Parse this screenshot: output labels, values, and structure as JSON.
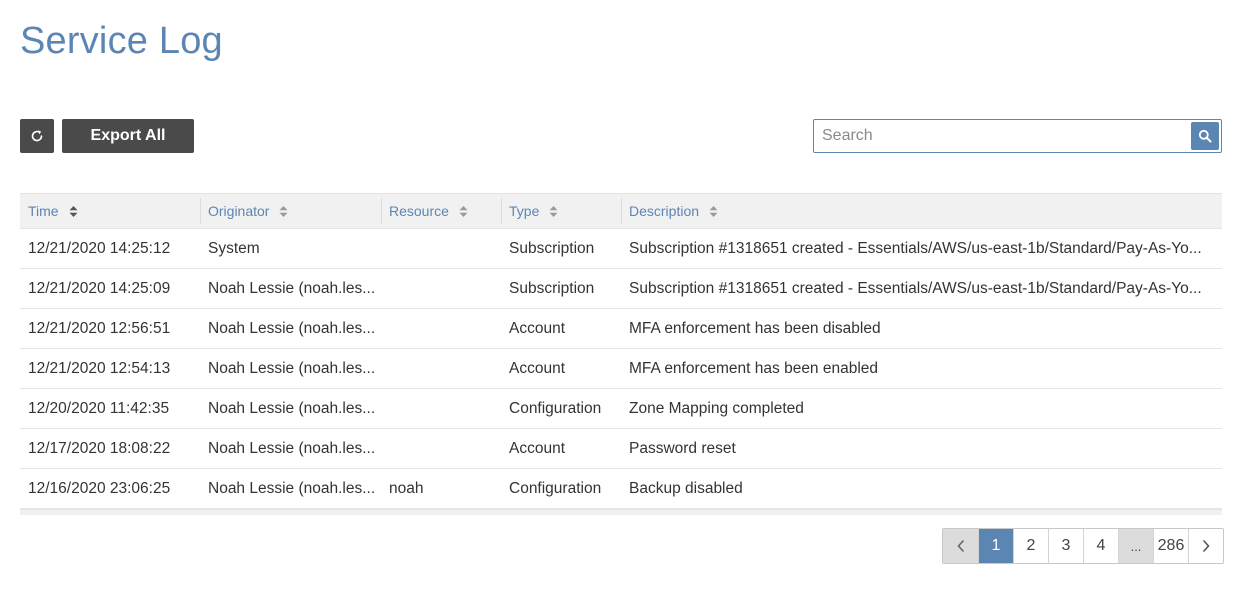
{
  "page": {
    "title": "Service Log"
  },
  "toolbar": {
    "export_label": "Export All"
  },
  "search": {
    "placeholder": "Search",
    "value": ""
  },
  "table": {
    "columns": [
      "Time",
      "Originator",
      "Resource",
      "Type",
      "Description"
    ],
    "rows": [
      {
        "time": "12/21/2020  14:25:12",
        "originator": "System",
        "resource": "",
        "type": "Subscription",
        "description": "Subscription #1318651 created - Essentials/AWS/us-east-1b/Standard/Pay-As-Yo..."
      },
      {
        "time": "12/21/2020  14:25:09",
        "originator": "Noah Lessie (noah.les...",
        "resource": "",
        "type": "Subscription",
        "description": "Subscription #1318651 created - Essentials/AWS/us-east-1b/Standard/Pay-As-Yo..."
      },
      {
        "time": "12/21/2020  12:56:51",
        "originator": "Noah Lessie (noah.les...",
        "resource": "",
        "type": "Account",
        "description": "MFA enforcement has been disabled"
      },
      {
        "time": "12/21/2020  12:54:13",
        "originator": "Noah Lessie (noah.les...",
        "resource": "",
        "type": "Account",
        "description": "MFA enforcement has been enabled"
      },
      {
        "time": "12/20/2020  11:42:35",
        "originator": "Noah Lessie (noah.les...",
        "resource": "",
        "type": "Configuration",
        "description": "Zone Mapping completed"
      },
      {
        "time": "12/17/2020  18:08:22",
        "originator": "Noah Lessie (noah.les...",
        "resource": "",
        "type": "Account",
        "description": "Password reset"
      },
      {
        "time": "12/16/2020  23:06:25",
        "originator": "Noah Lessie (noah.les...",
        "resource": "noah",
        "type": "Configuration",
        "description": "Backup disabled"
      }
    ]
  },
  "pagination": {
    "pages": [
      "1",
      "2",
      "3",
      "4",
      "...",
      "286"
    ],
    "current": "1"
  },
  "icons": {
    "refresh": "refresh-icon",
    "search": "search-icon",
    "sort": "sort-icon",
    "prev": "chevron-left-icon",
    "next": "chevron-right-icon"
  },
  "colors": {
    "accent": "#5b86b4",
    "button_dark": "#4a4a4a",
    "header_bg": "#f1f1f1"
  }
}
